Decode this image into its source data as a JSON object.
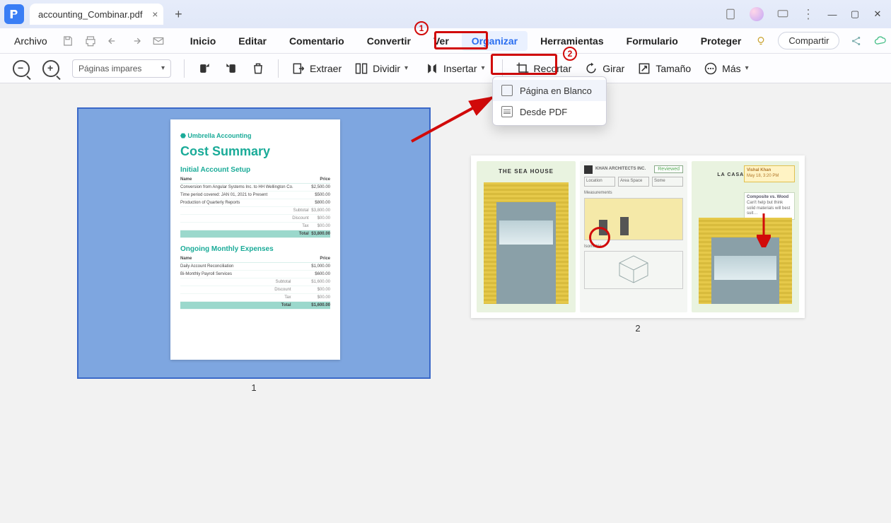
{
  "tab": {
    "title": "accounting_Combinar.pdf"
  },
  "menu": {
    "file": "Archivo",
    "items": [
      "Inicio",
      "Editar",
      "Comentario",
      "Convertir",
      "Ver",
      "Organizar",
      "Herramientas",
      "Formulario",
      "Proteger"
    ],
    "active_index": 5,
    "share": "Compartir"
  },
  "toolbar": {
    "page_select": "Páginas impares",
    "extract": "Extraer",
    "split": "Dividir",
    "insert": "Insertar",
    "crop": "Recortar",
    "rotate": "Girar",
    "size": "Tamaño",
    "more": "Más"
  },
  "dropdown": {
    "blank": "Página en Blanco",
    "from_pdf": "Desde PDF"
  },
  "annotations": {
    "step1": "1",
    "step2": "2"
  },
  "page_numbers": {
    "p1": "1",
    "p2": "2"
  },
  "doc1": {
    "brand": "Umbrella Accounting",
    "title": "Cost Summary",
    "setup_heading": "Initial Account Setup",
    "col_name": "Name",
    "col_price": "Price",
    "rows_setup": [
      {
        "name": "Conversion from Angular Systems Inc. to HH Wellington Co.",
        "price": "$2,500.00"
      },
      {
        "name": "Time period covered: JAN 01, 2021 to Present",
        "price": "$500.00"
      },
      {
        "name": "Production of Quarterly Reports",
        "price": "$800.00"
      }
    ],
    "subtotal_label": "Subtotal",
    "subtotal": "$3,800.00",
    "discount_label": "Discount",
    "discount": "$00.00",
    "tax_label": "Tax",
    "tax": "$00.00",
    "total_label": "Total",
    "total": "$3,800.00",
    "ongoing_heading": "Ongoing Monthly Expenses",
    "rows_ongoing": [
      {
        "name": "Daily Account Reconciliation",
        "price": "$1,000.00"
      },
      {
        "name": "Bi-Monthly Payroll Services",
        "price": "$600.00"
      }
    ],
    "o_subtotal": "$1,600.00",
    "o_discount": "$00.00",
    "o_tax": "$00.00",
    "o_total": "$1,600.00"
  },
  "doc2": {
    "left_title": "THE SEA HOUSE",
    "mid_brand": "KHAN ARCHITECTS INC.",
    "mid_tag": "Reviewed",
    "mid_h1": "Location",
    "mid_h2": "Area Space",
    "mid_h3": "Some",
    "mid_meas": "Measurements",
    "mid_iso": "Isometric",
    "right_title": "LA CASA DEL MAR",
    "right_sub": "Composite vs. Wood",
    "right_author": "Vishal Khan",
    "right_date": "May 18, 3:20 PM"
  }
}
